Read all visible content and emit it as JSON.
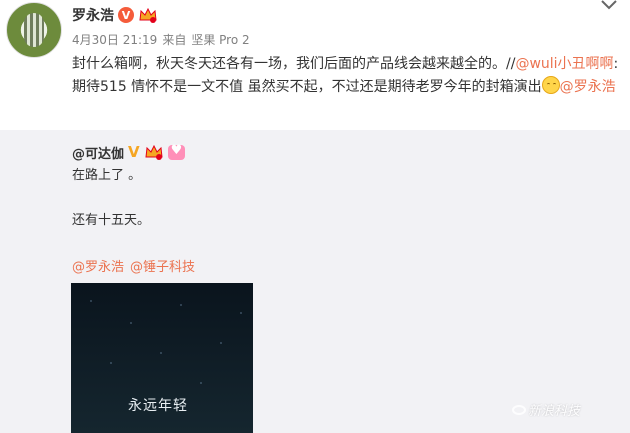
{
  "post": {
    "author": "罗永浩",
    "date": "4月30日 21:19",
    "source_prefix": "来自",
    "source": "坚果 Pro 2",
    "text_main": "封什么箱啊，秋天冬天还各有一场，我们后面的产品线会越来越全的。//",
    "mention_1": "@wuli小丑啊啊",
    "text_quote": ":期待515 情怀不是一文不值   虽然买不起，不过还是期待老罗今年的封箱演出",
    "emoji_icon": "smile-emoji-icon",
    "mention_2": "@罗永浩"
  },
  "repost": {
    "author": "@可达伽",
    "line1": "在路上了 。",
    "line2": "还有十五天。",
    "link1": "@罗永浩",
    "link2": "@锤子科技",
    "video_caption": "永远年轻"
  },
  "watermark": "新浪科技",
  "colors": {
    "link": "#eb7350",
    "repost_bg": "#f2f2f5",
    "verified": "#f55c3b",
    "gold": "#f5a623"
  }
}
